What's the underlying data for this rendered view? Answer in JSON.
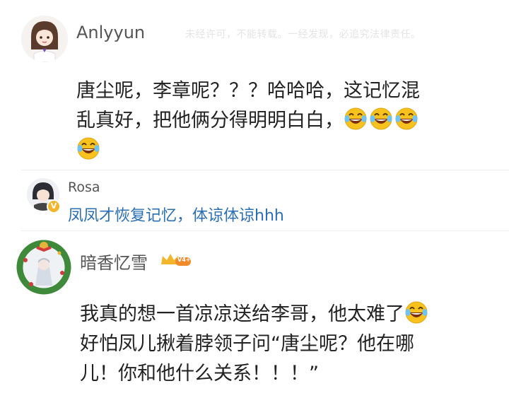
{
  "watermark": "未经许可，不能转载。一经发现，必追究法律责任。",
  "comments": [
    {
      "username": "Anlyyun",
      "text_line1": "唐尘呢，李章呢？？？哈哈哈，这记忆混",
      "text_line2": "乱真好，把他俩分得明明白白，",
      "emoji_name": "laugh-cry-emoji"
    },
    {
      "username": "Rosa",
      "text": "凤凤才恢复记忆，体谅体谅hhh",
      "verified_badge": "V"
    },
    {
      "username": "暗香忆雪",
      "level_badge": "V4+",
      "text_line1": "我真的想一首凉凉送给李哥，他太难了",
      "text_line2": "好怕凤儿揪着脖领子问“唐尘呢？他在哪",
      "text_line3": "儿！你和他什么关系！！！”"
    }
  ],
  "colors": {
    "link_blue": "#2a6fb5",
    "badge_gold": "#f3b52a",
    "emoji_yellow": "#f7c21d"
  }
}
